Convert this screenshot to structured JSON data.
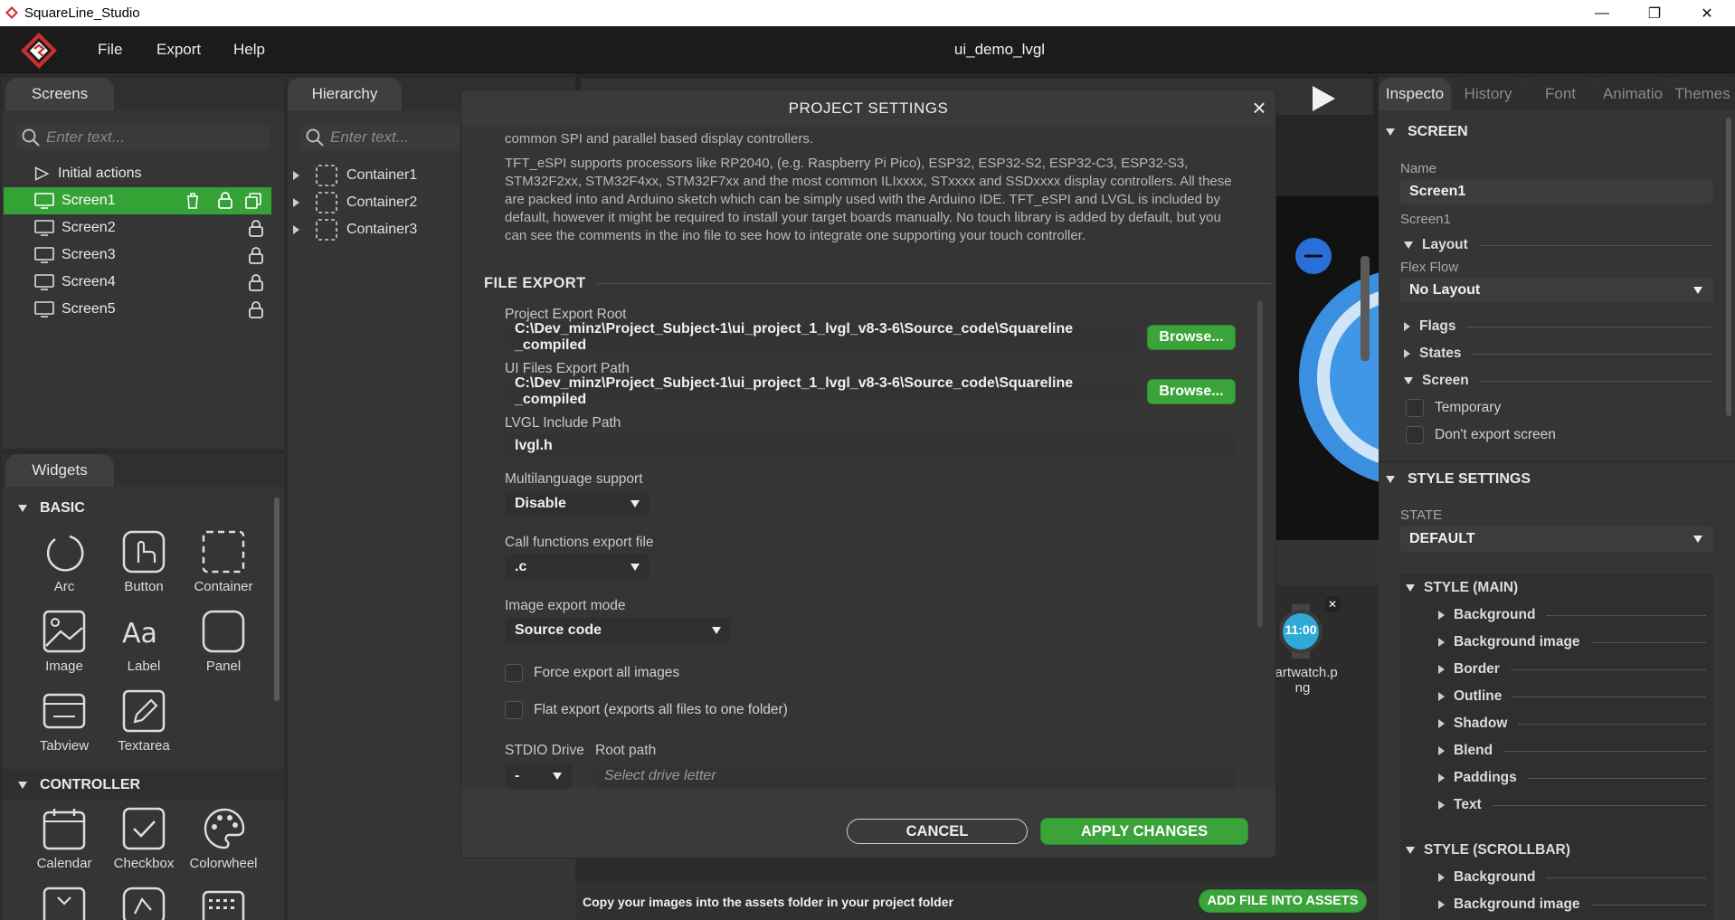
{
  "window": {
    "app_title": "SquareLine_Studio",
    "minimize": "—",
    "maximize": "❐",
    "close": "✕"
  },
  "menubar": {
    "file": "File",
    "export": "Export",
    "help": "Help",
    "project_name": "ui_demo_lvgl"
  },
  "screens_panel": {
    "tab": "Screens",
    "search_placeholder": "Enter text...",
    "initial_actions": "Initial actions",
    "screens": [
      "Screen1",
      "Screen2",
      "Screen3",
      "Screen4",
      "Screen5"
    ]
  },
  "hierarchy_panel": {
    "tab": "Hierarchy",
    "search_placeholder": "Enter text...",
    "items": [
      "Container1",
      "Container2",
      "Container3"
    ]
  },
  "widgets_panel": {
    "tab": "Widgets",
    "basic_header": "BASIC",
    "basic": [
      "Arc",
      "Button",
      "Container",
      "Image",
      "Label",
      "Panel",
      "Tabview",
      "Textarea"
    ],
    "controller_header": "CONTROLLER",
    "controller": [
      "Calendar",
      "Checkbox",
      "Colorwheel"
    ]
  },
  "project_settings": {
    "title": "PROJECT SETTINGS",
    "desc1": "common SPI and parallel based display controllers.",
    "desc2": "TFT_eSPI supports processors like RP2040, (e.g. Raspberry Pi Pico), ESP32, ESP32-S2, ESP32-C3, ESP32-S3, STM32F2xx, STM32F4xx, STM32F7xx and the most common ILIxxxx, STxxxx and SSDxxxx display controllers. All these are packed into and Arduino sketch which can be simply used with the Arduino IDE. TFT_eSPI and LVGL is included by default, however it might be required to install your target boards manually.  No touch library is added by default, but you can see the comments in the ino file to see how to integrate one supporting your touch controller.",
    "file_export_header": "FILE EXPORT",
    "export_root_label": "Project Export Root",
    "export_root_value": "C:\\Dev_minz\\Project_Subject-1\\ui_project_1_lvgl_v8-3-6\\Source_code\\Squareline _compiled",
    "ui_files_label": "UI Files Export Path",
    "ui_files_value": "C:\\Dev_minz\\Project_Subject-1\\ui_project_1_lvgl_v8-3-6\\Source_code\\Squareline _compiled",
    "browse": "Browse...",
    "lvgl_include_label": "LVGL Include Path",
    "lvgl_include_value": "lvgl.h",
    "multilang_label": "Multilanguage support",
    "multilang_value": "Disable",
    "call_funcs_label": "Call functions export file",
    "call_funcs_value": ".c",
    "image_mode_label": "Image export mode",
    "image_mode_value": "Source code",
    "force_export": "Force export all images",
    "flat_export": "Flat export (exports all files to one folder)",
    "stdio_label": "STDIO Drive",
    "stdio_value": "-",
    "root_path_label": "Root path",
    "root_path_placeholder": "Select drive letter",
    "cancel": "CANCEL",
    "apply": "APPLY CHANGES"
  },
  "assets_bar": {
    "hint": "Copy your images into the assets folder in your project folder",
    "add_button": "ADD FILE INTO ASSETS",
    "asset_name_line1": "nartwatch.p",
    "asset_name_line2": "ng",
    "asset_time": "11:00"
  },
  "inspector": {
    "tabs": [
      "Inspecto",
      "History",
      "Font",
      "Animatio",
      "Themes"
    ],
    "screen_header": "SCREEN",
    "name_label": "Name",
    "name_value": "Screen1",
    "screen_sub": "Screen1",
    "layout": "Layout",
    "flex_flow_label": "Flex Flow",
    "flex_flow_value": "No Layout",
    "flags": "Flags",
    "states": "States",
    "screen": "Screen",
    "temporary": "Temporary",
    "dont_export": "Don't export screen",
    "style_settings_header": "STYLE SETTINGS",
    "state_label": "STATE",
    "state_value": "DEFAULT",
    "style_main": "STYLE (MAIN)",
    "style_main_items": [
      "Background",
      "Background image",
      "Border",
      "Outline",
      "Shadow",
      "Blend",
      "Paddings",
      "Text"
    ],
    "style_scrollbar": "STYLE (SCROLLBAR)",
    "style_scrollbar_items": [
      "Background",
      "Background image"
    ]
  },
  "colors": {
    "accent_green": "#3aa43a",
    "panel_bg": "#303030",
    "modal_bg": "#3a3a3a"
  }
}
